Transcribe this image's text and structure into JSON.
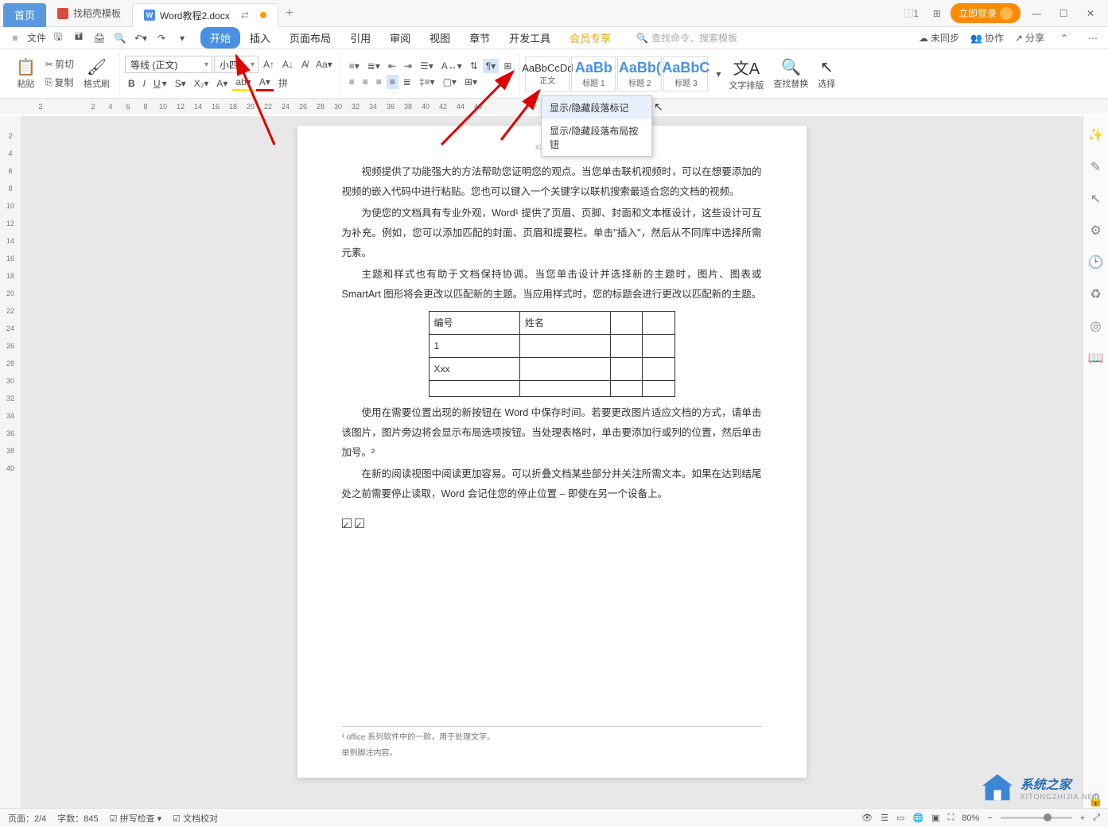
{
  "titlebar": {
    "tabs": {
      "home": "首页",
      "template": "找稻壳模板",
      "doc": "Word教程2.docx"
    },
    "login": "立即登录"
  },
  "menu": {
    "file": "文件",
    "tabs": [
      "开始",
      "插入",
      "页面布局",
      "引用",
      "审阅",
      "视图",
      "章节",
      "开发工具",
      "会员专享"
    ],
    "search_placeholder": "查找命令、搜索模板",
    "right": {
      "unsync": "未同步",
      "coop": "协作",
      "share": "分享"
    }
  },
  "ribbon": {
    "paste": "粘贴",
    "cut": "剪切",
    "copy": "复制",
    "format_painter": "格式刷",
    "font_name": "等线 (正文)",
    "font_size": "小四",
    "styles": [
      {
        "preview": "AaBbCcDd",
        "name": "正文",
        "cls": ""
      },
      {
        "preview": "AaBb",
        "name": "标题 1",
        "cls": "big"
      },
      {
        "preview": "AaBb(",
        "name": "标题 2",
        "cls": "big"
      },
      {
        "preview": "AaBbC",
        "name": "标题 3",
        "cls": "big"
      }
    ],
    "text_layout": "文字排版",
    "find_replace": "查找替换",
    "select": "选择"
  },
  "dropdown": {
    "item1": "显示/隐藏段落标记",
    "item2": "显示/隐藏段落布局按钮"
  },
  "ruler_h": [
    2,
    "",
    "",
    2,
    4,
    6,
    8,
    10,
    12,
    14,
    16,
    18,
    20,
    22,
    24,
    26,
    28,
    30,
    32,
    34,
    36,
    38,
    40,
    42,
    44,
    46
  ],
  "ruler_v": [
    2,
    4,
    6,
    8,
    10,
    12,
    14,
    16,
    18,
    20,
    22,
    24,
    26,
    28,
    30,
    32,
    34,
    36,
    38,
    40
  ],
  "document": {
    "header": "xxx 公司",
    "p1": "视频提供了功能强大的方法帮助您证明您的观点。当您单击联机视频时，可以在想要添加的视频的嵌入代码中进行粘贴。您也可以键入一个关键字以联机搜索最适合您的文档的视频。",
    "p2": "为使您的文档具有专业外观，Word¹ 提供了页眉、页脚、封面和文本框设计，这些设计可互为补充。例如，您可以添加匹配的封面、页眉和提要栏。单击\"插入\"，然后从不同库中选择所需元素。",
    "p3": "主题和样式也有助于文档保持协调。当您单击设计并选择新的主题时，图片、图表或 SmartArt 图形将会更改以匹配新的主题。当应用样式时，您的标题会进行更改以匹配新的主题。",
    "table": {
      "h1": "编号",
      "h2": "姓名",
      "r1c1": "1",
      "r2c1": "Xxx"
    },
    "p4": "使用在需要位置出现的新按钮在 Word 中保存时间。若要更改图片适应文档的方式，请单击该图片，图片旁边将会显示布局选项按钮。当处理表格时，单击要添加行或列的位置，然后单击加号。²",
    "p5": "在新的阅读视图中阅读更加容易。可以折叠文档某些部分并关注所需文本。如果在达到结尾处之前需要停止读取，Word 会记住您的停止位置 – 即使在另一个设备上。",
    "fn1": "¹ office 系列软件中的一款，用于处理文字。",
    "fn2": "举例脚注内容。"
  },
  "statusbar": {
    "page": "页面：2/4",
    "words": "字数：845",
    "spell": "拼写检查",
    "proof": "文档校对",
    "zoom": "80%"
  },
  "watermark": {
    "line1": "系统之家",
    "line2": "XITONGZHIJIA.NET"
  }
}
